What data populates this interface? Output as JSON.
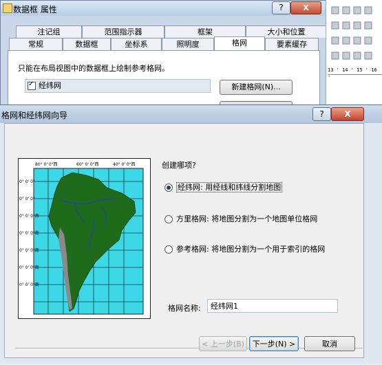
{
  "bg_dialog": {
    "title": "数据框 属性",
    "help": "?",
    "close": "X",
    "tabs_back": [
      "注记组",
      "范围指示器",
      "框架",
      "大小和位置"
    ],
    "tabs_front": [
      "常规",
      "数据框",
      "坐标系",
      "照明度",
      "格网",
      "要素缓存"
    ],
    "active_tab": "格网",
    "description": "只能在布局视图中的数据框上绘制参考格网。",
    "grid_item": "经纬网",
    "new_grid_button": "新建格网(N)..."
  },
  "ruler_text": "13 ' 14 ' 15 ' 16 '",
  "wizard": {
    "title": "格网和经纬网向导",
    "help": "?",
    "close": "X",
    "question": "创建哪项?",
    "options": [
      {
        "label": "经纬网: 用经线和纬线分割地图",
        "selected": true
      },
      {
        "label": "方里格网: 将地图分割为一个地图单位格网",
        "selected": false
      },
      {
        "label": "参考格网: 将地图分割为一个用于索引的格网",
        "selected": false
      }
    ],
    "name_label": "格网名称:",
    "name_value": "经纬网1",
    "buttons": {
      "back": "< 上一步(B)",
      "next": "下一步(N) >",
      "cancel": "取消"
    }
  },
  "map_preview": {
    "top_labels": [
      "80° 0' 0\"西",
      "60° 0' 0\"西",
      "40° 0' 0\"西"
    ],
    "left_labels": [
      "0° 0' 0\"",
      "0° 0' 0\"",
      "0° 0' 0\"南",
      "0° 0' 0\"南",
      "0° 0' 0\"南",
      "0° 0' 0\"南",
      "0° 0' 0\"南"
    ],
    "colors": {
      "ocean": "#3cd8e6",
      "land": "#1f6b1c",
      "rivers": "#2a3fb0",
      "andes": "#8a8a8a"
    }
  }
}
